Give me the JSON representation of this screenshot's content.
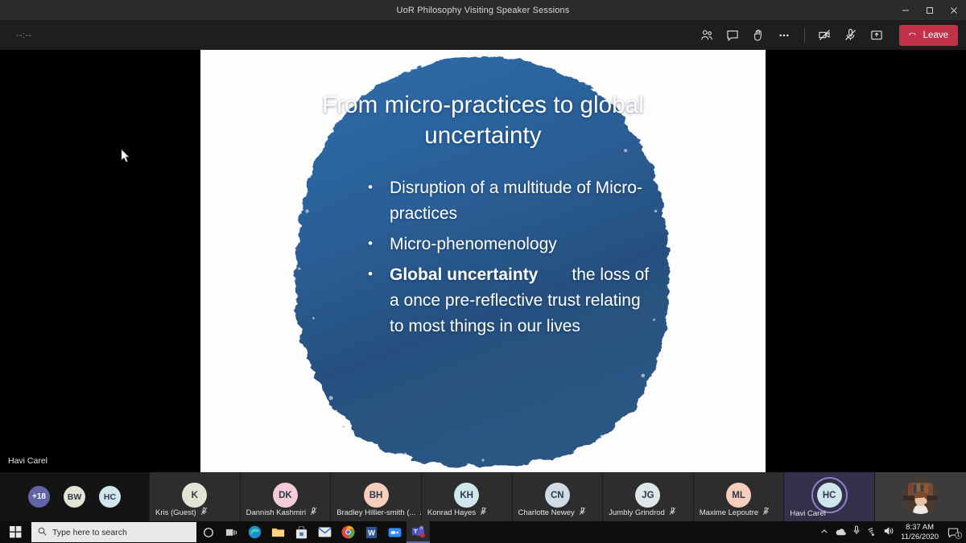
{
  "window": {
    "title": "UoR Philosophy Visiting Speaker Sessions",
    "minimize_label": "minimize-icon",
    "restore_label": "restore-icon",
    "close_label": "close-icon"
  },
  "meeting_toolbar": {
    "timer": "--:--",
    "buttons": [
      {
        "name": "participants-icon",
        "tooltip": "Show participants"
      },
      {
        "name": "chat-icon",
        "tooltip": "Show conversation"
      },
      {
        "name": "raise-hand-icon",
        "tooltip": "Raise your hand"
      },
      {
        "name": "more-options-icon",
        "tooltip": "More actions"
      },
      {
        "name": "camera-off-icon",
        "tooltip": "Turn camera on"
      },
      {
        "name": "mic-off-icon",
        "tooltip": "Unmute"
      },
      {
        "name": "share-screen-icon",
        "tooltip": "Share content"
      }
    ],
    "leave_label": "Leave",
    "leave_icon": "hang-up-icon",
    "leave_color": "#c4314b"
  },
  "stage": {
    "presenter_name": "Havi Carel",
    "slide": {
      "title": "From micro-practices to global uncertainty",
      "bullets": [
        {
          "text": "Disruption of a multitude of Micro-practices",
          "bold": "",
          "tail": ""
        },
        {
          "text": "Micro-phenomenology",
          "bold": "",
          "tail": ""
        },
        {
          "text": "",
          "bold": "Global uncertainty",
          "tail": "the loss of a once pre-reflective trust relating to most things in our lives"
        }
      ],
      "accent_color": "#2e6aa8",
      "background_color": "#fdfdfd"
    }
  },
  "filmstrip": {
    "overflow": {
      "count_label": "+18",
      "minis": [
        "+18",
        "BW",
        "HC"
      ]
    },
    "participants": [
      {
        "initials": "K",
        "name": "Kris (Guest)",
        "muted": true,
        "active": false,
        "avatar_color": "#e2e5d3"
      },
      {
        "initials": "DK",
        "name": "Dannish Kashmiri",
        "muted": true,
        "active": false,
        "avatar_color": "#f3ccd8"
      },
      {
        "initials": "BH",
        "name": "Bradley Hillier-smith (...",
        "muted": true,
        "active": false,
        "avatar_color": "#f7cdbb"
      },
      {
        "initials": "KH",
        "name": "Konrad Hayes",
        "muted": true,
        "active": false,
        "avatar_color": "#cfe7ea"
      },
      {
        "initials": "CN",
        "name": "Charlotte Newey",
        "muted": true,
        "active": false,
        "avatar_color": "#cfdce6"
      },
      {
        "initials": "JG",
        "name": "Jumbly Grindrod",
        "muted": true,
        "active": false,
        "avatar_color": "#dde7e9"
      },
      {
        "initials": "ML",
        "name": "Maxime Lepoutre",
        "muted": true,
        "active": false,
        "avatar_color": "#f7cdbb"
      },
      {
        "initials": "HC",
        "name": "Havi Carel",
        "muted": false,
        "active": true,
        "avatar_color": "#cfe7ea"
      }
    ],
    "video_tile": {
      "name": "video-participant",
      "has_video": true
    },
    "active_ring_color": "#8b83c9"
  },
  "taskbar": {
    "start_label": "windows-start-icon",
    "search_placeholder": "Type here to search",
    "icons": [
      {
        "name": "cortana-icon"
      },
      {
        "name": "task-view-icon"
      },
      {
        "name": "edge-icon"
      },
      {
        "name": "file-explorer-icon"
      },
      {
        "name": "microsoft-store-icon"
      },
      {
        "name": "mail-icon"
      },
      {
        "name": "chrome-icon"
      },
      {
        "name": "word-icon"
      },
      {
        "name": "zoom-icon"
      },
      {
        "name": "teams-icon"
      }
    ],
    "tray": {
      "chevron": "show-hidden-icons",
      "onedrive": "onedrive-icon",
      "microphone": "microphone-icon",
      "wifi": "wifi-icon",
      "volume": "volume-icon",
      "time": "8:37 AM",
      "date": "11/26/2020",
      "notification_count": "1"
    }
  }
}
